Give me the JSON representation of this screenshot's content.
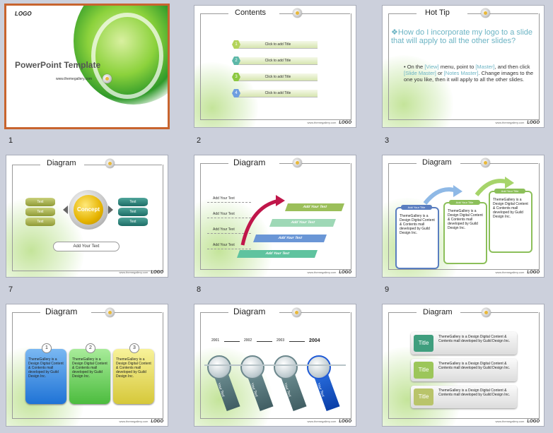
{
  "slides": [
    {
      "num": "1",
      "title": "PowerPoint Template",
      "logo": "LOGO",
      "url": "www.themegallery.com"
    },
    {
      "num": "2",
      "title": "Contents",
      "items": [
        {
          "n": "1",
          "label": "Click to add Title"
        },
        {
          "n": "2",
          "label": "Click to add Title"
        },
        {
          "n": "3",
          "label": "Click to add Title"
        },
        {
          "n": "4",
          "label": "Click to add Title"
        }
      ]
    },
    {
      "num": "3",
      "title": "Hot Tip",
      "question": "How do I incorporate my logo to a slide that will apply to all the other slides?",
      "body_parts": [
        "On the ",
        "[View]",
        " menu, point to ",
        "[Master]",
        ", and then click ",
        "[Slide Master]",
        " or ",
        "[Notes Master]",
        ". Change images to the one you like, then it will apply to all the other slides."
      ]
    },
    {
      "num": "7",
      "title": "Diagram",
      "left": [
        "Text",
        "Text",
        "Text"
      ],
      "right": [
        "Text",
        "Text",
        "Text"
      ],
      "center": "Concept",
      "bottom": "Add Your Text"
    },
    {
      "num": "8",
      "title": "Diagram",
      "rows": [
        "Add Your Text",
        "Add Your Text",
        "Add Your Text",
        "Add Your Text"
      ],
      "steps": [
        "Add Your Text",
        "Add Your Text",
        "Add Your Text",
        "Add Your Text"
      ]
    },
    {
      "num": "9",
      "title": "Diagram",
      "boxes": [
        {
          "tag": "Add Your Title",
          "text": "ThemeGallery is a Design Digital Content & Contents mall developed by Guild Design Inc."
        },
        {
          "tag": "Add Your Title",
          "text": "ThemeGallery is a Design Digital Content & Contents mall developed by Guild Design Inc."
        },
        {
          "tag": "Add Your Title",
          "text": "ThemeGallery is a Design Digital Content & Contents mall developed by Guild Design Inc."
        }
      ]
    },
    {
      "num": "",
      "title": "Diagram",
      "cards": [
        {
          "n": "1",
          "text": "ThemeGallery is a Design Digital Content & Contents mall developed by Guild Design Inc."
        },
        {
          "n": "2",
          "text": "ThemeGallery is a Design Digital Content & Contents mall developed by Guild Design Inc."
        },
        {
          "n": "3",
          "text": "ThemeGallery is a Design Digital Content & Contents mall developed by Guild Design Inc."
        }
      ]
    },
    {
      "num": "",
      "title": "Diagram",
      "years": [
        "2001",
        "2002",
        "2003",
        "2004"
      ],
      "tag": "Your Text"
    },
    {
      "num": "",
      "title": "Diagram",
      "rows": [
        {
          "tag": "Title",
          "text": "ThemeGallery is a Design Digital Content & Contents mall developed by Guild Design Inc."
        },
        {
          "tag": "Title",
          "text": "ThemeGallery is a Design Digital Content & Contents mall developed by Guild Design Inc."
        },
        {
          "tag": "Title",
          "text": "ThemeGallery is a Design Digital Content & Contents mall developed by Guild Design Inc."
        }
      ]
    }
  ],
  "footer": {
    "url": "www.themegallery.com",
    "logo": "LOGO"
  },
  "colors": {
    "selection": "#c8642e",
    "green": "#7fc241",
    "link": "#6cb4c4"
  }
}
